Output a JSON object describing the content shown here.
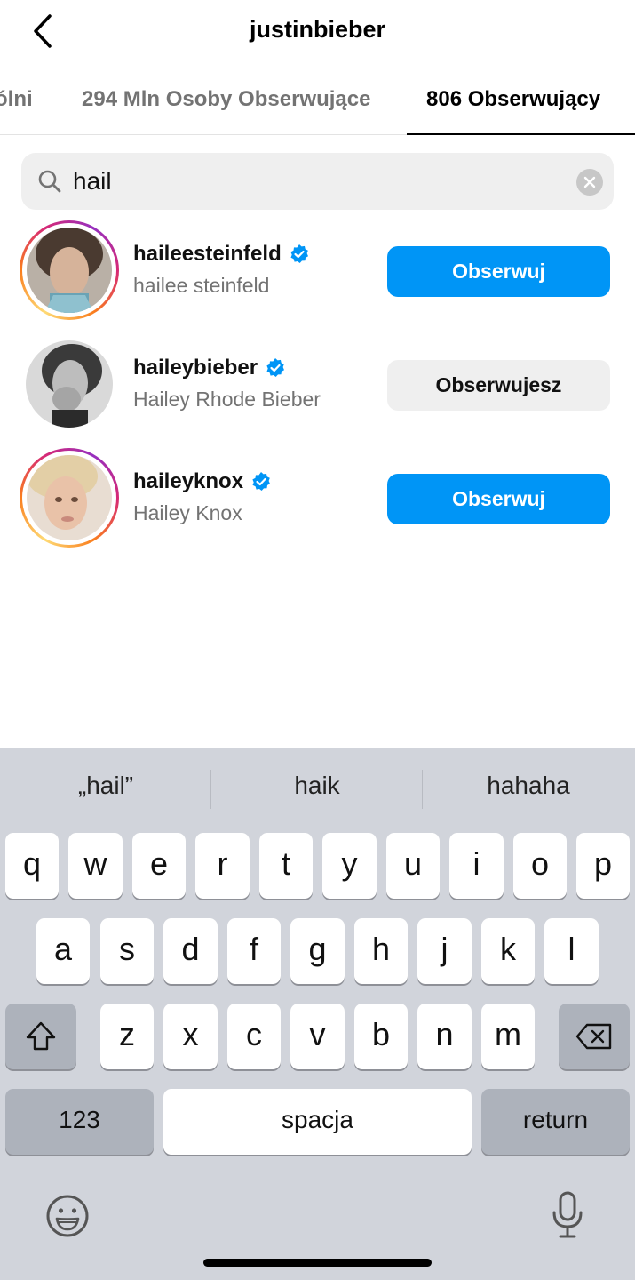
{
  "header": {
    "title": "justinbieber"
  },
  "tabs": [
    {
      "label": "ólni"
    },
    {
      "label": "294 Mln Osoby Obserwujące"
    },
    {
      "label": "806 Obserwujący"
    }
  ],
  "search": {
    "value": "hail"
  },
  "users": [
    {
      "username": "haileesteinfeld",
      "fullname": "hailee steinfeld",
      "button": "Obserwuj",
      "verified": true,
      "story": true
    },
    {
      "username": "haileybieber",
      "fullname": "Hailey Rhode Bieber",
      "button": "Obserwujesz",
      "verified": true,
      "story": false
    },
    {
      "username": "haileyknox",
      "fullname": "Hailey Knox",
      "button": "Obserwuj",
      "verified": true,
      "story": true
    }
  ],
  "keyboard": {
    "suggestions": [
      "„hail”",
      "haik",
      "hahaha"
    ],
    "row1": [
      "q",
      "w",
      "e",
      "r",
      "t",
      "y",
      "u",
      "i",
      "o",
      "p"
    ],
    "row2": [
      "a",
      "s",
      "d",
      "f",
      "g",
      "h",
      "j",
      "k",
      "l"
    ],
    "row3": [
      "z",
      "x",
      "c",
      "v",
      "b",
      "n",
      "m"
    ],
    "numbers_label": "123",
    "space_label": "spacja",
    "return_label": "return"
  },
  "colors": {
    "follow_button": "#0095f6",
    "following_button": "#efefef",
    "verified": "#0095f6",
    "keyboard_bg": "#d1d4db"
  },
  "icons": [
    "back-arrow-icon",
    "search-icon",
    "clear-icon",
    "verified-icon",
    "shift-icon",
    "backspace-icon",
    "emoji-icon",
    "microphone-icon"
  ]
}
